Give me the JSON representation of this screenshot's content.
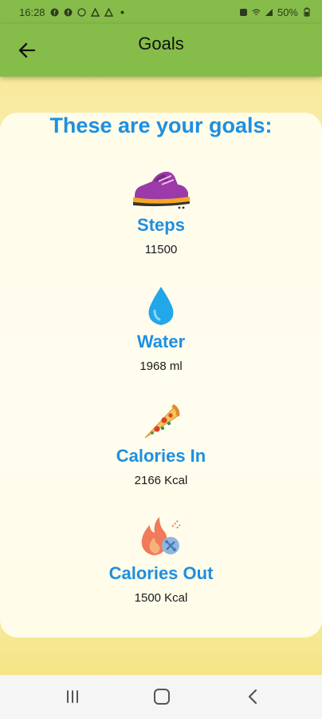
{
  "status_bar": {
    "time": "16:28",
    "battery": "50%",
    "notification_icons": [
      "facebook-icon",
      "facebook-icon",
      "whatsapp-icon",
      "app-icon",
      "app-icon",
      "dot-icon"
    ],
    "system_icons": [
      "alarm-icon",
      "wifi-icon",
      "signal-icon",
      "battery-icon"
    ]
  },
  "app_bar": {
    "title": "Goals",
    "back_icon": "arrow-left-icon",
    "color": "#86bd4a"
  },
  "card": {
    "title": "These are your goals:",
    "accent": "#1e8fe0"
  },
  "goals": [
    {
      "icon": "sneaker-icon",
      "label": "Steps",
      "value": "11500"
    },
    {
      "icon": "water-drop-icon",
      "label": "Water",
      "value": "1968 ml"
    },
    {
      "icon": "pizza-icon",
      "label": "Calories In",
      "value": "2166 Kcal"
    },
    {
      "icon": "fire-icon",
      "label": "Calories Out",
      "value": "1500 Kcal"
    }
  ],
  "nav_bar": {
    "buttons": [
      "recents-icon",
      "home-icon",
      "back-icon"
    ]
  }
}
